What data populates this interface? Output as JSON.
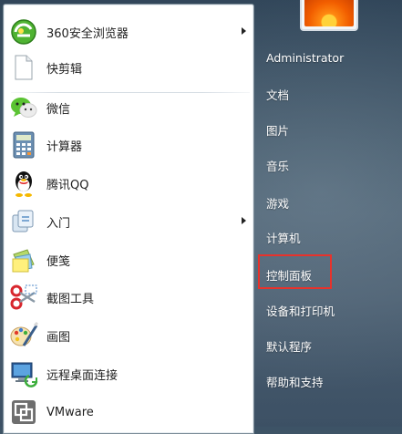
{
  "programs": [
    {
      "label": "360安全浏览器",
      "icon": "360-browser-icon",
      "has_submenu": true
    },
    {
      "label": "快剪辑",
      "icon": "document-icon",
      "has_submenu": false
    },
    {
      "label": "微信",
      "icon": "wechat-icon",
      "has_submenu": false
    },
    {
      "label": "计算器",
      "icon": "calculator-icon",
      "has_submenu": false
    },
    {
      "label": "腾讯QQ",
      "icon": "qq-penguin-icon",
      "has_submenu": false
    },
    {
      "label": "入门",
      "icon": "getting-started-icon",
      "has_submenu": true
    },
    {
      "label": "便笺",
      "icon": "sticky-notes-icon",
      "has_submenu": false
    },
    {
      "label": "截图工具",
      "icon": "snipping-tool-icon",
      "has_submenu": false
    },
    {
      "label": "画图",
      "icon": "paint-icon",
      "has_submenu": false
    },
    {
      "label": "远程桌面连接",
      "icon": "remote-desktop-icon",
      "has_submenu": false
    },
    {
      "label": "VMware",
      "icon": "vmware-icon",
      "has_submenu": false
    }
  ],
  "right_pane": {
    "user": "Administrator",
    "items": [
      "文档",
      "图片",
      "音乐",
      "游戏",
      "计算机",
      "控制面板",
      "设备和打印机",
      "默认程序",
      "帮助和支持"
    ],
    "highlighted_item": "控制面板"
  },
  "colors": {
    "highlight_border": "#e8322b",
    "right_text": "#ffffff",
    "left_text": "#1e1e1e"
  }
}
